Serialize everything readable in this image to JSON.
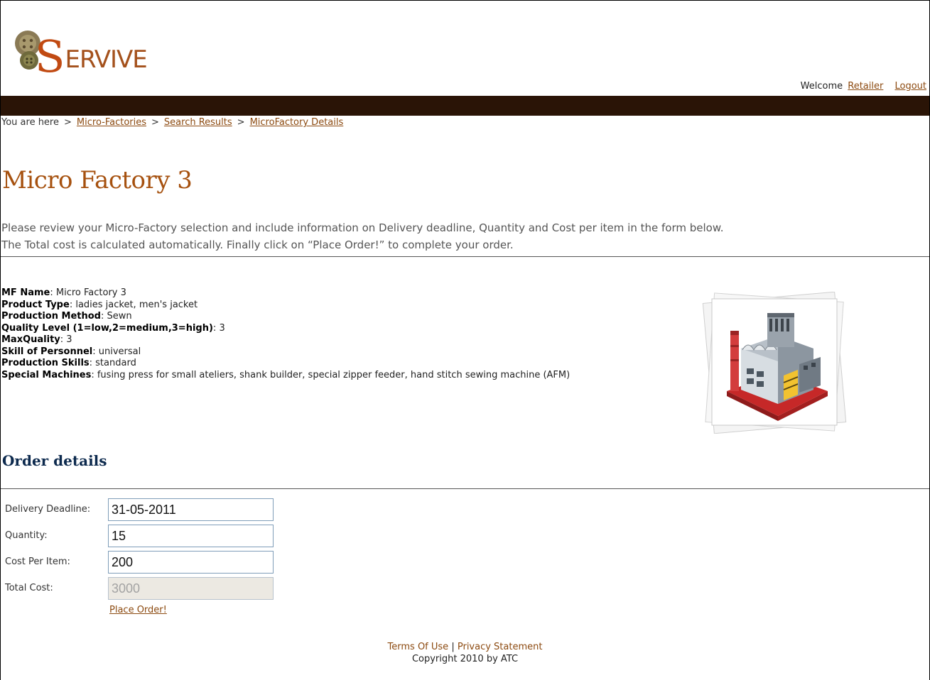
{
  "header": {
    "logo_text_initial": "S",
    "logo_text_rest": "ERVIVE",
    "welcome_text": "Welcome",
    "user_link": "Retailer",
    "logout_link": "Logout"
  },
  "breadcrumb": {
    "prefix": "You are here",
    "separator": ">",
    "items": [
      "Micro-Factories",
      "Search Results",
      "MicroFactory Details"
    ]
  },
  "page": {
    "title": "Micro Factory 3",
    "intro_line1": "Please review your Micro-Factory selection and include information on Delivery deadline, Quantity and Cost per item in the form below.",
    "intro_line2": "The Total cost is calculated automatically. Finally click on “Place Order!” to complete your order."
  },
  "details": [
    {
      "label": "MF Name",
      "value": "Micro Factory 3"
    },
    {
      "label": "Product Type",
      "value": "ladies jacket, men's jacket"
    },
    {
      "label": "Production Method",
      "value": "Sewn"
    },
    {
      "label": "Quality Level (1=low,2=medium,3=high)",
      "value": "3"
    },
    {
      "label": "MaxQuality",
      "value": "3"
    },
    {
      "label": "Skill of Personnel",
      "value": "universal"
    },
    {
      "label": "Production Skills",
      "value": "standard"
    },
    {
      "label": "Special Machines",
      "value": "fusing press for small ateliers, shank builder, special zipper feeder, hand stitch sewing machine (AFM)"
    }
  ],
  "order": {
    "title": "Order details",
    "delivery_label": "Delivery Deadline:",
    "delivery_value": "31-05-2011",
    "quantity_label": "Quantity:",
    "quantity_value": "15",
    "cost_label": "Cost Per Item:",
    "cost_value": "200",
    "total_label": "Total Cost:",
    "total_value": "3000",
    "place_order": "Place Order!"
  },
  "footer": {
    "terms": "Terms Of Use",
    "divider": "|",
    "privacy": "Privacy Statement",
    "copyright": "Copyright 2010 by ATC"
  },
  "colors": {
    "brand_brown": "#a6510f",
    "top_bar": "#2a1406",
    "order_title": "#0d2a4e"
  }
}
